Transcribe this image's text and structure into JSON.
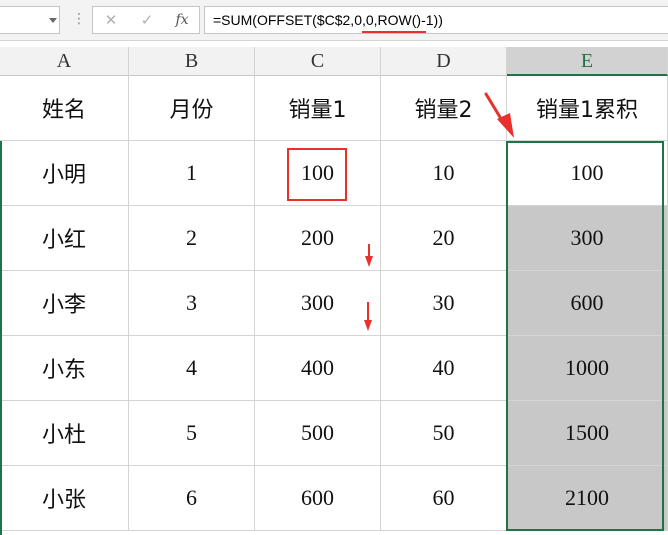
{
  "formula_bar": {
    "name_box": "",
    "dots": "⋮",
    "cancel_glyph": "✕",
    "confirm_glyph": "✓",
    "fx_label": "fx",
    "formula": "=SUM(OFFSET($C$2,0,0,ROW()-1))"
  },
  "columns": [
    "A",
    "B",
    "C",
    "D",
    "E"
  ],
  "selected_column": "E",
  "header_row": [
    "姓名",
    "月份",
    "销量1",
    "销量2",
    "销量1累积"
  ],
  "rows": [
    [
      "小明",
      "1",
      "100",
      "10",
      "100"
    ],
    [
      "小红",
      "2",
      "200",
      "20",
      "300"
    ],
    [
      "小李",
      "3",
      "300",
      "30",
      "600"
    ],
    [
      "小东",
      "4",
      "400",
      "40",
      "1000"
    ],
    [
      "小杜",
      "5",
      "500",
      "50",
      "1500"
    ],
    [
      "小张",
      "6",
      "600",
      "60",
      "2100"
    ]
  ],
  "colors": {
    "selection": "#217346",
    "annotation": "#e8302c",
    "shaded_cell": "#c8c8c8"
  }
}
